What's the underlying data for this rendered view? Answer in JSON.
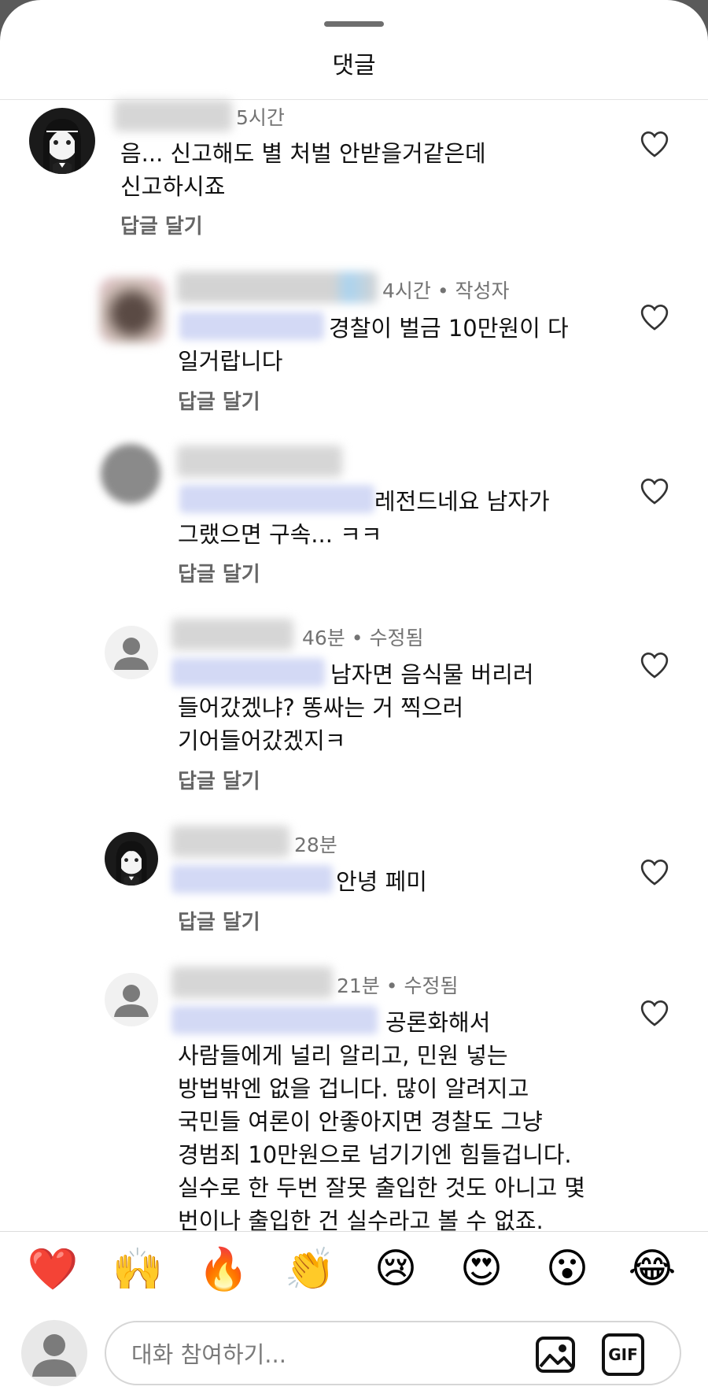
{
  "header": {
    "title": "댓글"
  },
  "comments": [
    {
      "time": "5시간",
      "text": "음... 신고해도 별 처벌 안받을거같은데\n신고하시죠",
      "reply_label": "답글 달기"
    },
    {
      "time": "4시간 • 작성자",
      "text": "경찰이 벌금 10만원이 다\n일거랍니다",
      "reply_label": "답글 달기"
    },
    {
      "time": "",
      "text": "레전드네요 남자가\n그랬으면 구속... ㅋㅋ",
      "reply_label": "답글 달기"
    },
    {
      "time": "46분 • 수정됨",
      "text": "남자면 음식물 버리러\n들어갔겠냐? 똥싸는 거 찍으러\n기어들어갔겠지ㅋ",
      "reply_label": "답글 달기"
    },
    {
      "time": "28분",
      "text": "안녕 페미",
      "reply_label": "답글 달기"
    },
    {
      "time": "21분 • 수정됨",
      "text": "공론화해서\n사람들에게 널리 알리고, 민원 넣는\n방법밖엔 없을 겁니다. 많이 알려지고\n국민들 여론이 안좋아지면 경찰도 그냥\n경범죄 10만원으로 넘기기엔 힘들겁니다.\n실수로 한 두번 잘못 출입한 것도 아니고 몇\n번이나 출입한 건 실수라고 볼 수 없죠.",
      "reply_label": ""
    }
  ],
  "reactions": [
    "❤️",
    "🙌",
    "🔥",
    "👏",
    "😢",
    "😍",
    "😮",
    "😂"
  ],
  "composer": {
    "placeholder": "대화 참여하기...",
    "gif_label": "GIF"
  }
}
